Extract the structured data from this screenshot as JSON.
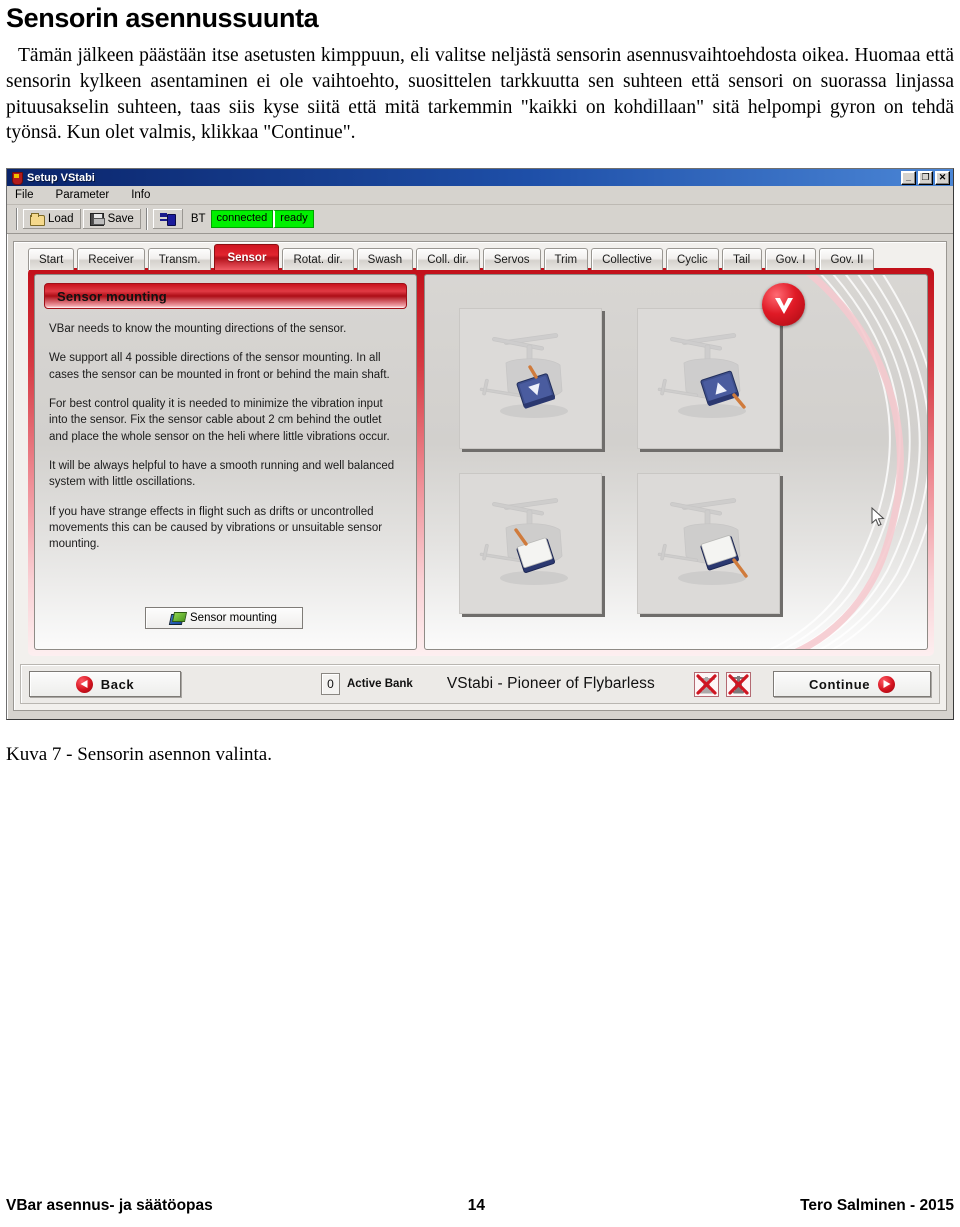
{
  "document": {
    "heading": "Sensorin asennussuunta",
    "paragraph": "Tämän jälkeen päästään itse asetusten kimppuun, eli valitse neljästä sensorin asennusvaihtoehdosta oikea. Huomaa että sensorin kylkeen asentaminen ei ole vaihtoehto, suosittelen tarkkuutta sen suhteen että sensori on suorassa linjassa pituusakselin suhteen, taas siis kyse siitä että mitä tarkemmin \"kaikki on kohdillaan\" sitä helpompi gyron on tehdä työnsä. Kun olet valmis, klikkaa \"Continue\".",
    "caption": "Kuva 7 - Sensorin asennon valinta.",
    "footer": {
      "left": "VBar asennus- ja säätöopas",
      "page": "14",
      "right": "Tero Salminen - 2015"
    }
  },
  "app": {
    "title": "Setup VStabi",
    "window_buttons": {
      "minimize": "_",
      "maximize": "❐",
      "close": "✕"
    },
    "menu": [
      "File",
      "Parameter",
      "Info"
    ],
    "toolbar": {
      "load_label": "Load",
      "save_label": "Save",
      "bt_label": "BT",
      "status": [
        "connected",
        "ready"
      ]
    },
    "tabs": [
      {
        "label": "Start",
        "active": false
      },
      {
        "label": "Receiver",
        "active": false
      },
      {
        "label": "Transm.",
        "active": false
      },
      {
        "label": "Sensor",
        "active": true
      },
      {
        "label": "Rotat. dir.",
        "active": false
      },
      {
        "label": "Swash",
        "active": false
      },
      {
        "label": "Coll. dir.",
        "active": false
      },
      {
        "label": "Servos",
        "active": false
      },
      {
        "label": "Trim",
        "active": false
      },
      {
        "label": "Collective",
        "active": false
      },
      {
        "label": "Cyclic",
        "active": false
      },
      {
        "label": "Tail",
        "active": false
      },
      {
        "label": "Gov. I",
        "active": false
      },
      {
        "label": "Gov. II",
        "active": false
      }
    ],
    "panel": {
      "header": "Sensor mounting",
      "paragraphs": [
        "VBar needs to know the mounting directions of the sensor.",
        "We support all 4 possible directions of the sensor mounting. In all cases the sensor can be mounted in front or behind the main shaft.",
        "For best control quality it is needed to minimize the vibration input into the sensor. Fix the sensor cable about 2 cm behind the outlet and place the whole sensor on the heli where little vibrations occur.",
        "It will be always helpful to have a smooth running and well balanced system with little oscillations.",
        "If you have strange effects in flight such as drifts or uncontrolled movements this can be caused by vibrations or unsuitable sensor mounting."
      ],
      "mount_button": "Sensor mounting"
    },
    "mount_options": [
      {
        "id": "option-1",
        "selected": false,
        "sensor_color": "#3a4a86",
        "marker": "▼"
      },
      {
        "id": "option-2",
        "selected": true,
        "sensor_color": "#3a4a86",
        "marker": "▲"
      },
      {
        "id": "option-3",
        "selected": false,
        "sensor_color": "#f2f2f2",
        "marker": ""
      },
      {
        "id": "option-4",
        "selected": false,
        "sensor_color": "#f2f2f2",
        "marker": ""
      }
    ],
    "bottom": {
      "back_label": "Back",
      "continue_label": "Continue",
      "active_bank_value": "0",
      "active_bank_label": "Active Bank",
      "brand": "VStabi - Pioneer of Flybarless"
    }
  },
  "colors": {
    "accent_red": "#cf1622",
    "titlebar_blue": "#0a246a",
    "status_green": "#00f000",
    "window_gray": "#d6d3ce"
  }
}
